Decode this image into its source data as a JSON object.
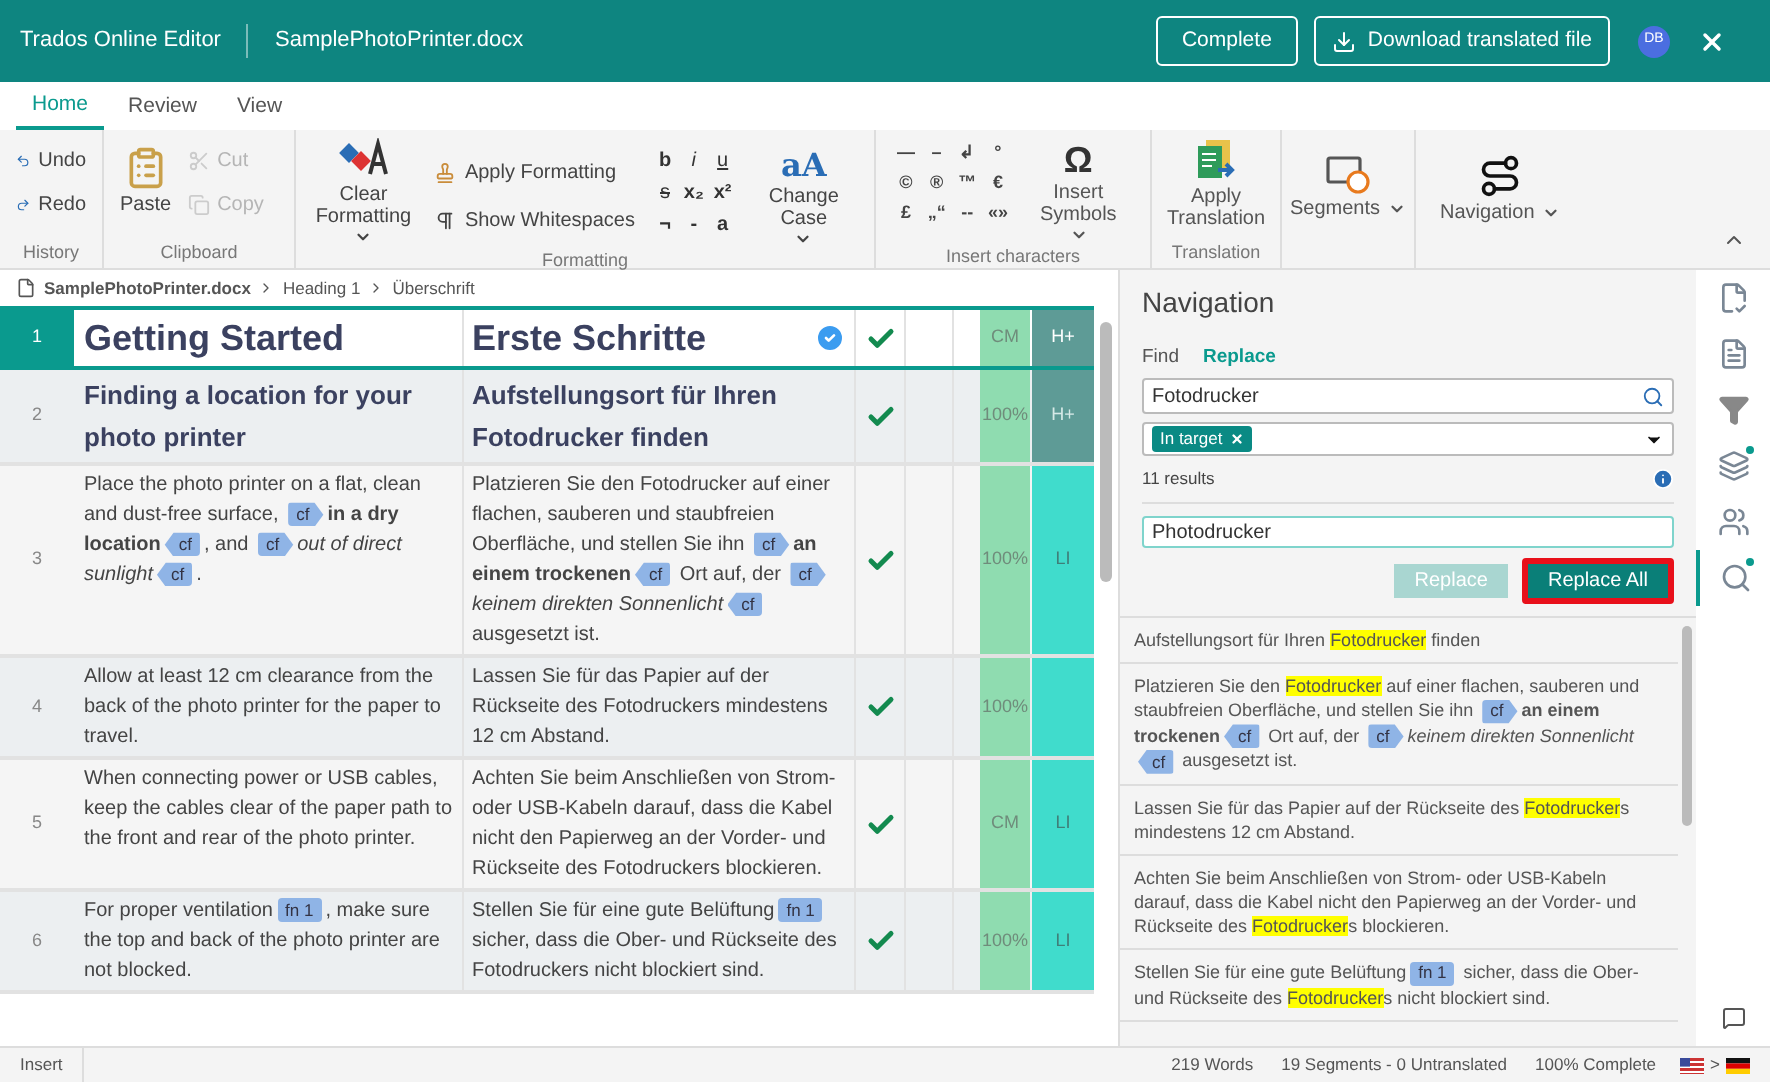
{
  "app": {
    "title": "Trados Online Editor",
    "document": "SamplePhotoPrinter.docx",
    "complete_button": "Complete",
    "download_button": "Download translated file",
    "avatar": "DB"
  },
  "ribbon_tabs": [
    {
      "label": "Home",
      "selected": true
    },
    {
      "label": "Review",
      "selected": false
    },
    {
      "label": "View",
      "selected": false
    }
  ],
  "ribbon": {
    "history": {
      "label": "History",
      "items": [
        {
          "label": "Undo",
          "disabled": false
        },
        {
          "label": "Redo",
          "disabled": false
        }
      ]
    },
    "clipboard": {
      "label": "Clipboard",
      "paste": "Paste",
      "items": [
        {
          "label": "Cut",
          "disabled": true
        },
        {
          "label": "Copy",
          "disabled": true
        }
      ]
    },
    "formatting": {
      "label": "Formatting",
      "clear": "Clear Formatting",
      "apply": "Apply Formatting",
      "whitespace": "Show Whitespaces",
      "chars": [
        "b",
        "i",
        "u",
        "s",
        "x₂",
        "x²",
        "¬",
        "-",
        "a"
      ],
      "case_glyph": "aA",
      "change_case": "Change Case"
    },
    "insert": {
      "label": "Insert characters",
      "chars": [
        "—",
        "–",
        "↲",
        "°",
        "©",
        "®",
        "™",
        "€",
        "£",
        "„“",
        "--",
        "«»"
      ],
      "symbol_glyph": "Ω",
      "symbols": "Insert Symbols"
    },
    "translation": {
      "label": "Translation",
      "apply": "Apply Translation"
    },
    "segments": "Segments",
    "navigation": "Navigation"
  },
  "breadcrumb": [
    "SamplePhotoPrinter.docx",
    "Heading 1",
    "Überschrift"
  ],
  "segments": [
    {
      "number": "1",
      "kind": "title",
      "selected": true,
      "confirmed": true,
      "match": "CM",
      "status": "H+",
      "source": [
        {
          "kind": "plain",
          "text": "Getting Started"
        }
      ],
      "target": [
        {
          "kind": "plain",
          "text": "Erste Schritte"
        }
      ]
    },
    {
      "number": "2",
      "kind": "heading",
      "selected": false,
      "confirmed": true,
      "match": "100%",
      "status": "H+",
      "source": [
        {
          "kind": "plain",
          "text": "Finding a location for your photo printer"
        }
      ],
      "target": [
        {
          "kind": "plain",
          "text": "Aufstellungsort für Ihren Fotodrucker finden"
        }
      ]
    },
    {
      "number": "3",
      "kind": "body",
      "selected": false,
      "confirmed": true,
      "match": "100%",
      "status": "LI",
      "source": [
        {
          "kind": "plain",
          "text": "Place the photo printer on a flat, clean and dust-free surface, "
        },
        {
          "kind": "tag_open",
          "text": "cf"
        },
        {
          "kind": "bold",
          "text": "in a dry location"
        },
        {
          "kind": "tag_close",
          "text": "cf"
        },
        {
          "kind": "plain",
          "text": ", and "
        },
        {
          "kind": "tag_open",
          "text": "cf"
        },
        {
          "kind": "italic",
          "text": "out of direct sunlight"
        },
        {
          "kind": "tag_close",
          "text": "cf"
        },
        {
          "kind": "plain",
          "text": "."
        }
      ],
      "target": [
        {
          "kind": "plain",
          "text": "Platzieren Sie den Fotodrucker auf einer flachen, sauberen und staubfreien Oberfläche, und stellen Sie ihn "
        },
        {
          "kind": "tag_open",
          "text": "cf"
        },
        {
          "kind": "bold",
          "text": "an einem trockenen"
        },
        {
          "kind": "tag_close",
          "text": "cf"
        },
        {
          "kind": "plain",
          "text": " Ort auf, der "
        },
        {
          "kind": "tag_open",
          "text": "cf"
        },
        {
          "kind": "italic",
          "text": "keinem direkten Sonnenlicht"
        },
        {
          "kind": "tag_close",
          "text": "cf"
        },
        {
          "kind": "plain",
          "text": " ausgesetzt ist."
        }
      ]
    },
    {
      "number": "4",
      "kind": "body",
      "selected": false,
      "confirmed": true,
      "match": "100%",
      "source": [
        {
          "kind": "plain",
          "text": "Allow at least 12 cm clearance from the back of the photo printer for the paper to travel."
        }
      ],
      "target": [
        {
          "kind": "plain",
          "text": "Lassen Sie für das Papier auf der Rückseite des Fotodruckers mindestens 12 cm Abstand."
        }
      ]
    },
    {
      "number": "5",
      "kind": "body",
      "selected": false,
      "confirmed": true,
      "match": "CM",
      "status": "LI",
      "source": [
        {
          "kind": "plain",
          "text": "When connecting power or USB cables, keep the cables clear of the paper path to the front and rear of the photo printer."
        }
      ],
      "target": [
        {
          "kind": "plain",
          "text": "Achten Sie beim Anschließen von Strom- oder USB-Kabeln darauf, dass die Kabel nicht den Papierweg an der Vorder- und Rückseite des Fotodruckers blockieren."
        }
      ]
    },
    {
      "number": "6",
      "kind": "body",
      "selected": false,
      "confirmed": true,
      "match": "100%",
      "status": "LI",
      "source": [
        {
          "kind": "plain",
          "text": "For proper ventilation"
        },
        {
          "kind": "tag",
          "text": "fn 1"
        },
        {
          "kind": "plain",
          "text": ", make sure the top and back of the photo printer are not blocked."
        }
      ],
      "target": [
        {
          "kind": "plain",
          "text": "Stellen Sie für eine gute Belüftung"
        },
        {
          "kind": "tag",
          "text": "fn 1"
        },
        {
          "kind": "plain",
          "text": " sicher, dass die Ober- und Rückseite des Fotodruckers nicht blockiert sind."
        }
      ]
    }
  ],
  "navigation": {
    "title": "Navigation",
    "tabs": [
      {
        "label": "Find",
        "selected": false
      },
      {
        "label": "Replace",
        "selected": true
      }
    ],
    "find_value": "Fotodrucker",
    "filter_chip": "In target",
    "results_count": "11 results",
    "replace_value": "Photodrucker",
    "buttons": [
      {
        "label": "Replace",
        "disabled": true,
        "highlighted": false
      },
      {
        "label": "Replace All",
        "disabled": false,
        "highlighted": true
      }
    ],
    "results": [
      [
        {
          "kind": "plain",
          "text": "Aufstellungsort für Ihren "
        },
        {
          "kind": "highlight",
          "text": "Fotodrucker"
        },
        {
          "kind": "plain",
          "text": " finden"
        }
      ],
      [
        {
          "kind": "plain",
          "text": "Platzieren Sie den "
        },
        {
          "kind": "highlight",
          "text": "Fotodrucker"
        },
        {
          "kind": "plain",
          "text": " auf einer flachen, sauberen und staubfreien Oberfläche, und stellen Sie ihn "
        },
        {
          "kind": "tag_open",
          "text": "cf"
        },
        {
          "kind": "bold",
          "text": "an einem trockenen"
        },
        {
          "kind": "tag_close",
          "text": "cf"
        },
        {
          "kind": "plain",
          "text": " Ort auf, der "
        },
        {
          "kind": "tag_open",
          "text": "cf"
        },
        {
          "kind": "italic",
          "text": "keinem direkten Sonnenlicht"
        },
        {
          "kind": "tag_close",
          "text": "cf"
        },
        {
          "kind": "plain",
          "text": " ausgesetzt ist."
        }
      ],
      [
        {
          "kind": "plain",
          "text": "Lassen Sie für das Papier auf der Rückseite des "
        },
        {
          "kind": "highlight",
          "text": "Fotodrucker"
        },
        {
          "kind": "plain",
          "text": "s mindestens 12 cm Abstand."
        }
      ],
      [
        {
          "kind": "plain",
          "text": "Achten Sie beim Anschließen von Strom- oder USB-Kabeln darauf, dass die Kabel nicht den Papierweg an der Vorder- und Rückseite des "
        },
        {
          "kind": "highlight",
          "text": "Fotodrucker"
        },
        {
          "kind": "plain",
          "text": "s blockieren."
        }
      ],
      [
        {
          "kind": "plain",
          "text": "Stellen Sie für eine gute Belüftung"
        },
        {
          "kind": "tag",
          "text": "fn 1"
        },
        {
          "kind": "plain",
          "text": " sicher, dass die Ober- und Rückseite des "
        },
        {
          "kind": "highlight",
          "text": "Fotodrucker"
        },
        {
          "kind": "plain",
          "text": "s nicht blockiert sind."
        }
      ]
    ]
  },
  "rail": [
    {
      "selected": false,
      "dot": false
    },
    {
      "selected": false,
      "dot": false
    },
    {
      "selected": false,
      "dot": false
    },
    {
      "selected": false,
      "dot": true
    },
    {
      "selected": false,
      "dot": false
    },
    {
      "selected": true,
      "dot": true
    }
  ],
  "status_bar": {
    "mode": "Insert",
    "words": "219 Words",
    "segments": "19 Segments - 0 Untranslated",
    "complete": "100% Complete",
    "lang_separator": ">"
  }
}
